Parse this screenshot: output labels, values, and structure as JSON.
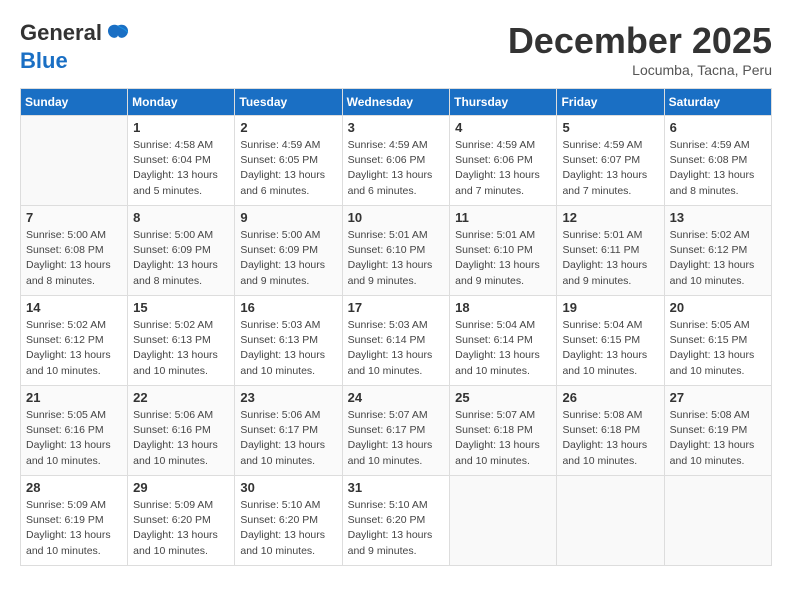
{
  "header": {
    "logo": {
      "general": "General",
      "blue": "Blue"
    },
    "title": "December 2025",
    "location": "Locumba, Tacna, Peru"
  },
  "weekdays": [
    "Sunday",
    "Monday",
    "Tuesday",
    "Wednesday",
    "Thursday",
    "Friday",
    "Saturday"
  ],
  "weeks": [
    [
      {
        "day": "",
        "info": ""
      },
      {
        "day": "1",
        "info": "Sunrise: 4:58 AM\nSunset: 6:04 PM\nDaylight: 13 hours\nand 5 minutes."
      },
      {
        "day": "2",
        "info": "Sunrise: 4:59 AM\nSunset: 6:05 PM\nDaylight: 13 hours\nand 6 minutes."
      },
      {
        "day": "3",
        "info": "Sunrise: 4:59 AM\nSunset: 6:06 PM\nDaylight: 13 hours\nand 6 minutes."
      },
      {
        "day": "4",
        "info": "Sunrise: 4:59 AM\nSunset: 6:06 PM\nDaylight: 13 hours\nand 7 minutes."
      },
      {
        "day": "5",
        "info": "Sunrise: 4:59 AM\nSunset: 6:07 PM\nDaylight: 13 hours\nand 7 minutes."
      },
      {
        "day": "6",
        "info": "Sunrise: 4:59 AM\nSunset: 6:08 PM\nDaylight: 13 hours\nand 8 minutes."
      }
    ],
    [
      {
        "day": "7",
        "info": "Sunrise: 5:00 AM\nSunset: 6:08 PM\nDaylight: 13 hours\nand 8 minutes."
      },
      {
        "day": "8",
        "info": "Sunrise: 5:00 AM\nSunset: 6:09 PM\nDaylight: 13 hours\nand 8 minutes."
      },
      {
        "day": "9",
        "info": "Sunrise: 5:00 AM\nSunset: 6:09 PM\nDaylight: 13 hours\nand 9 minutes."
      },
      {
        "day": "10",
        "info": "Sunrise: 5:01 AM\nSunset: 6:10 PM\nDaylight: 13 hours\nand 9 minutes."
      },
      {
        "day": "11",
        "info": "Sunrise: 5:01 AM\nSunset: 6:10 PM\nDaylight: 13 hours\nand 9 minutes."
      },
      {
        "day": "12",
        "info": "Sunrise: 5:01 AM\nSunset: 6:11 PM\nDaylight: 13 hours\nand 9 minutes."
      },
      {
        "day": "13",
        "info": "Sunrise: 5:02 AM\nSunset: 6:12 PM\nDaylight: 13 hours\nand 10 minutes."
      }
    ],
    [
      {
        "day": "14",
        "info": "Sunrise: 5:02 AM\nSunset: 6:12 PM\nDaylight: 13 hours\nand 10 minutes."
      },
      {
        "day": "15",
        "info": "Sunrise: 5:02 AM\nSunset: 6:13 PM\nDaylight: 13 hours\nand 10 minutes."
      },
      {
        "day": "16",
        "info": "Sunrise: 5:03 AM\nSunset: 6:13 PM\nDaylight: 13 hours\nand 10 minutes."
      },
      {
        "day": "17",
        "info": "Sunrise: 5:03 AM\nSunset: 6:14 PM\nDaylight: 13 hours\nand 10 minutes."
      },
      {
        "day": "18",
        "info": "Sunrise: 5:04 AM\nSunset: 6:14 PM\nDaylight: 13 hours\nand 10 minutes."
      },
      {
        "day": "19",
        "info": "Sunrise: 5:04 AM\nSunset: 6:15 PM\nDaylight: 13 hours\nand 10 minutes."
      },
      {
        "day": "20",
        "info": "Sunrise: 5:05 AM\nSunset: 6:15 PM\nDaylight: 13 hours\nand 10 minutes."
      }
    ],
    [
      {
        "day": "21",
        "info": "Sunrise: 5:05 AM\nSunset: 6:16 PM\nDaylight: 13 hours\nand 10 minutes."
      },
      {
        "day": "22",
        "info": "Sunrise: 5:06 AM\nSunset: 6:16 PM\nDaylight: 13 hours\nand 10 minutes."
      },
      {
        "day": "23",
        "info": "Sunrise: 5:06 AM\nSunset: 6:17 PM\nDaylight: 13 hours\nand 10 minutes."
      },
      {
        "day": "24",
        "info": "Sunrise: 5:07 AM\nSunset: 6:17 PM\nDaylight: 13 hours\nand 10 minutes."
      },
      {
        "day": "25",
        "info": "Sunrise: 5:07 AM\nSunset: 6:18 PM\nDaylight: 13 hours\nand 10 minutes."
      },
      {
        "day": "26",
        "info": "Sunrise: 5:08 AM\nSunset: 6:18 PM\nDaylight: 13 hours\nand 10 minutes."
      },
      {
        "day": "27",
        "info": "Sunrise: 5:08 AM\nSunset: 6:19 PM\nDaylight: 13 hours\nand 10 minutes."
      }
    ],
    [
      {
        "day": "28",
        "info": "Sunrise: 5:09 AM\nSunset: 6:19 PM\nDaylight: 13 hours\nand 10 minutes."
      },
      {
        "day": "29",
        "info": "Sunrise: 5:09 AM\nSunset: 6:20 PM\nDaylight: 13 hours\nand 10 minutes."
      },
      {
        "day": "30",
        "info": "Sunrise: 5:10 AM\nSunset: 6:20 PM\nDaylight: 13 hours\nand 10 minutes."
      },
      {
        "day": "31",
        "info": "Sunrise: 5:10 AM\nSunset: 6:20 PM\nDaylight: 13 hours\nand 9 minutes."
      },
      {
        "day": "",
        "info": ""
      },
      {
        "day": "",
        "info": ""
      },
      {
        "day": "",
        "info": ""
      }
    ]
  ]
}
